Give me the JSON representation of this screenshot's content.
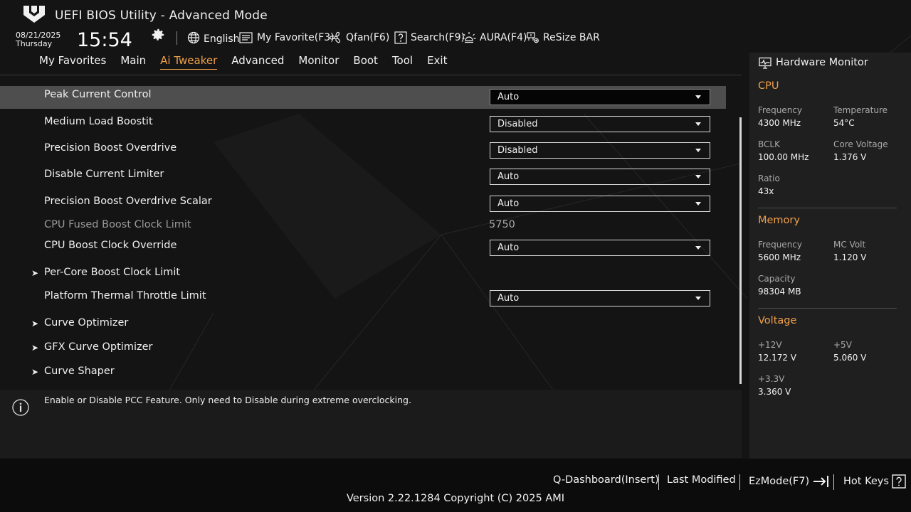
{
  "header": {
    "title": "UEFI BIOS Utility - Advanced Mode",
    "date": "08/21/2025",
    "weekday": "Thursday",
    "time": "15:54",
    "logo_icon": "tuf-logo-icon",
    "toolbar": [
      {
        "label": "English",
        "icon": "globe-icon"
      },
      {
        "label": "My Favorite(F3)",
        "icon": "favorites-icon"
      },
      {
        "label": "Qfan(F6)",
        "icon": "fan-icon"
      },
      {
        "label": "Search(F9)",
        "icon": "search-icon"
      },
      {
        "label": "AURA(F4)",
        "icon": "aura-icon"
      },
      {
        "label": "ReSize BAR",
        "icon": "resize-bar-icon"
      }
    ]
  },
  "tabs": [
    {
      "label": "My Favorites",
      "active": false
    },
    {
      "label": "Main",
      "active": false
    },
    {
      "label": "Ai Tweaker",
      "active": true
    },
    {
      "label": "Advanced",
      "active": false
    },
    {
      "label": "Monitor",
      "active": false
    },
    {
      "label": "Boot",
      "active": false
    },
    {
      "label": "Tool",
      "active": false
    },
    {
      "label": "Exit",
      "active": false
    }
  ],
  "settings": [
    {
      "label": "Peak Current Control",
      "value": "Auto",
      "type": "dropdown",
      "selected": true
    },
    {
      "label": "Medium Load Boostit",
      "value": "Disabled",
      "type": "dropdown"
    },
    {
      "label": "Precision Boost Overdrive",
      "value": "Disabled",
      "type": "dropdown"
    },
    {
      "label": "Disable Current Limiter",
      "value": "Auto",
      "type": "dropdown"
    },
    {
      "label": "Precision Boost Overdrive Scalar",
      "value": "Auto",
      "type": "dropdown"
    },
    {
      "label": "CPU Fused Boost Clock Limit",
      "value": "5750",
      "type": "static"
    },
    {
      "label": "CPU Boost Clock Override",
      "value": "Auto",
      "type": "dropdown"
    },
    {
      "label": "Per-Core Boost Clock Limit",
      "type": "submenu"
    },
    {
      "label": "Platform Thermal Throttle Limit",
      "value": "Auto",
      "type": "dropdown"
    },
    {
      "label": "Curve Optimizer",
      "type": "submenu"
    },
    {
      "label": "GFX Curve Optimizer",
      "type": "submenu"
    },
    {
      "label": "Curve Shaper",
      "type": "submenu"
    }
  ],
  "help": {
    "text": "Enable or Disable PCC Feature. Only need to Disable during extreme overclocking."
  },
  "hardware_monitor": {
    "title": "Hardware Monitor",
    "cpu": {
      "section": "CPU",
      "frequency_label": "Frequency",
      "frequency": "4300 MHz",
      "temperature_label": "Temperature",
      "temperature": "54°C",
      "bclk_label": "BCLK",
      "bclk": "100.00 MHz",
      "core_voltage_label": "Core Voltage",
      "core_voltage": "1.376 V",
      "ratio_label": "Ratio",
      "ratio": "43x"
    },
    "memory": {
      "section": "Memory",
      "frequency_label": "Frequency",
      "frequency": "5600 MHz",
      "mc_volt_label": "MC Volt",
      "mc_volt": "1.120 V",
      "capacity_label": "Capacity",
      "capacity": "98304 MB"
    },
    "voltage": {
      "section": "Voltage",
      "v12_label": "+12V",
      "v12": "12.172 V",
      "v5_label": "+5V",
      "v5": "5.060 V",
      "v33_label": "+3.3V",
      "v33": "3.360 V"
    }
  },
  "footer": {
    "q_dashboard": "Q-Dashboard(Insert)",
    "last_modified": "Last Modified",
    "ezmode": "EzMode(F7)",
    "hot_keys": "Hot Keys",
    "version": "Version 2.22.1284 Copyright (C) 2025 AMI"
  },
  "colors": {
    "accent": "#f0a04a",
    "background": "#141414",
    "selected_row": "#4e4e4e"
  }
}
